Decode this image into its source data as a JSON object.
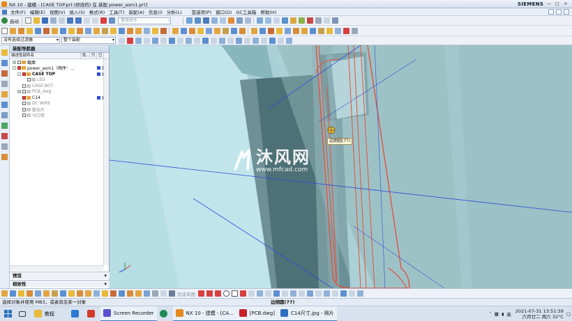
{
  "window": {
    "title": "NX 10 - 建模 - [CASE TOP.prt  (修改的)  在 装配 power_asm1.prt]",
    "brand": "SIEMENS",
    "controls": [
      "—",
      "□",
      "×"
    ]
  },
  "menu": {
    "items": [
      "文件(F)",
      "编辑(E)",
      "视图(V)",
      "插入(S)",
      "格式(R)",
      "工具(T)",
      "装配(A)",
      "信息(I)",
      "分析(L)",
      "首选项(P)",
      "窗口(O)",
      "GC工具箱",
      "帮助(H)"
    ]
  },
  "toolbar": {
    "start_label": "启动",
    "search_placeholder": "查找命令",
    "selection_filter": "没有选择过滤器",
    "assembly_scope": "整个装配"
  },
  "navigator": {
    "title": "装配导航器",
    "columns": [
      "描述性部件名",
      "轨..",
      "只",
      "已"
    ],
    "rows": [
      {
        "label": "截面",
        "indent": 0,
        "expand": "+",
        "checked": false,
        "grey": false
      },
      {
        "label": "power_asm1（顺序：...",
        "indent": 0,
        "expand": "-",
        "checked": true,
        "grey": false
      },
      {
        "label": "CASE TOP",
        "indent": 1,
        "expand": "-",
        "checked": true,
        "grey": false,
        "bold": true
      },
      {
        "label": "LED",
        "indent": 2,
        "expand": "",
        "checked": false,
        "grey": true
      },
      {
        "label": "CASE BOT",
        "indent": 1,
        "expand": "",
        "checked": false,
        "grey": true
      },
      {
        "label": "PCB_dwg",
        "indent": 1,
        "expand": "+",
        "checked": false,
        "grey": true
      },
      {
        "label": "C14",
        "indent": 1,
        "expand": "",
        "checked": true,
        "grey": false
      },
      {
        "label": "DC WIRE",
        "indent": 1,
        "expand": "",
        "checked": false,
        "grey": true
      },
      {
        "label": "散拉片",
        "indent": 1,
        "expand": "",
        "checked": false,
        "grey": true
      },
      {
        "label": "马口铁",
        "indent": 1,
        "expand": "",
        "checked": false,
        "grey": true
      }
    ],
    "footer": [
      "预览",
      "相依性"
    ]
  },
  "viewport": {
    "tooltip": "边倒圆(77)",
    "watermark_text": "沐风网",
    "watermark_url": "www.mfcad.com"
  },
  "bottom_toolbar": {
    "text": "完成草图"
  },
  "status": {
    "prompt": "选择对象并使用 MB3，或者双击某一对象",
    "selection": "边倒圆(77)"
  },
  "taskbar": {
    "items": [
      {
        "label": "教程",
        "color": "#e8b93a"
      },
      {
        "label": "",
        "color": "#2c78d4"
      },
      {
        "label": "",
        "color": "#d43a2c"
      },
      {
        "label": "Screen Recorder",
        "color": "#5a4fcf"
      },
      {
        "label": "",
        "color": "#1f8a56"
      },
      {
        "label": "NX 10 - 建模 - [CA...",
        "color": "#e58a1f"
      },
      {
        "label": "[PCB.dwg]",
        "color": "#c8202a"
      },
      {
        "label": "C14尺寸.jpg - 照片",
        "color": "#2f6fc0"
      }
    ],
    "ime": "英",
    "date": "2021-07-31 13:51:39",
    "weekday_weather": "六月廿二 周六 32°C"
  }
}
